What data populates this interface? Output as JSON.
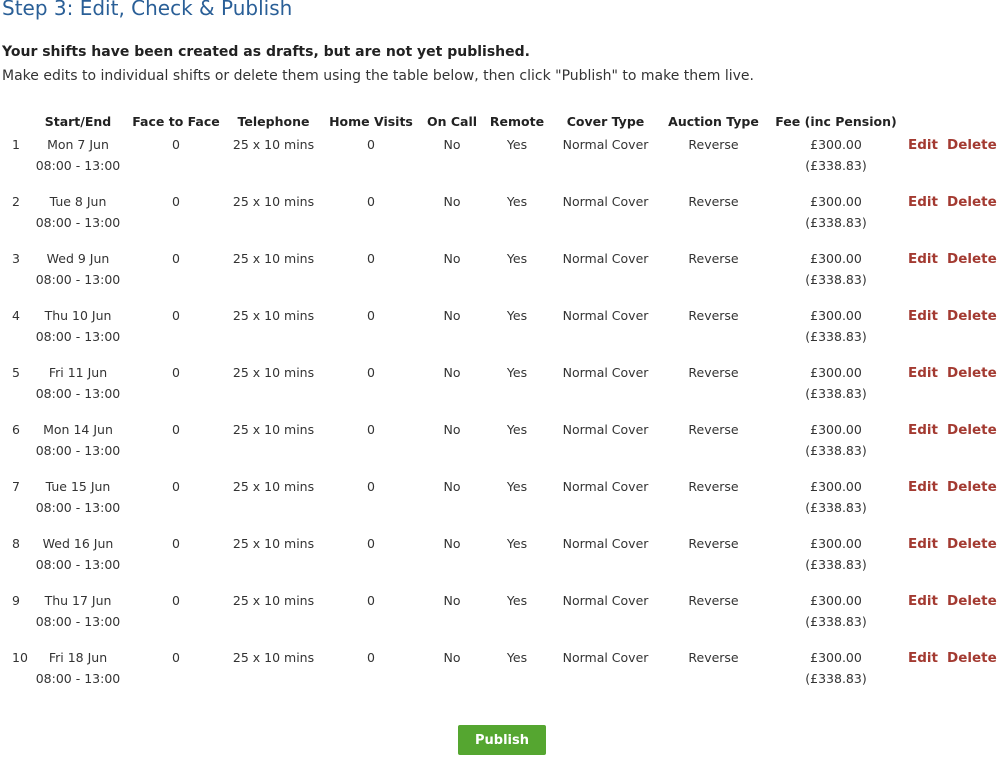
{
  "page": {
    "title": "Step 3: Edit, Check & Publish",
    "subhead": "Your shifts have been created as drafts, but are not yet published.",
    "instructions": "Make edits to individual shifts or delete them using the table below, then click \"Publish\" to make them live."
  },
  "table": {
    "headers": {
      "num": "",
      "start_end": "Start/End",
      "face_to_face": "Face to Face",
      "telephone": "Telephone",
      "home_visits": "Home Visits",
      "on_call": "On Call",
      "remote": "Remote",
      "cover_type": "Cover Type",
      "auction_type": "Auction Type",
      "fee": "Fee (inc Pension)"
    },
    "actions": {
      "edit": "Edit",
      "delete": "Delete"
    },
    "rows": [
      {
        "num": "1",
        "date": "Mon 7 Jun",
        "time": "08:00 - 13:00",
        "face_to_face": "0",
        "telephone": "25 x 10 mins",
        "home_visits": "0",
        "on_call": "No",
        "remote": "Yes",
        "cover_type": "Normal Cover",
        "auction_type": "Reverse",
        "fee": "£300.00",
        "fee_pension": "(£338.83)"
      },
      {
        "num": "2",
        "date": "Tue 8 Jun",
        "time": "08:00 - 13:00",
        "face_to_face": "0",
        "telephone": "25 x 10 mins",
        "home_visits": "0",
        "on_call": "No",
        "remote": "Yes",
        "cover_type": "Normal Cover",
        "auction_type": "Reverse",
        "fee": "£300.00",
        "fee_pension": "(£338.83)"
      },
      {
        "num": "3",
        "date": "Wed 9 Jun",
        "time": "08:00 - 13:00",
        "face_to_face": "0",
        "telephone": "25 x 10 mins",
        "home_visits": "0",
        "on_call": "No",
        "remote": "Yes",
        "cover_type": "Normal Cover",
        "auction_type": "Reverse",
        "fee": "£300.00",
        "fee_pension": "(£338.83)"
      },
      {
        "num": "4",
        "date": "Thu 10 Jun",
        "time": "08:00 - 13:00",
        "face_to_face": "0",
        "telephone": "25 x 10 mins",
        "home_visits": "0",
        "on_call": "No",
        "remote": "Yes",
        "cover_type": "Normal Cover",
        "auction_type": "Reverse",
        "fee": "£300.00",
        "fee_pension": "(£338.83)"
      },
      {
        "num": "5",
        "date": "Fri 11 Jun",
        "time": "08:00 - 13:00",
        "face_to_face": "0",
        "telephone": "25 x 10 mins",
        "home_visits": "0",
        "on_call": "No",
        "remote": "Yes",
        "cover_type": "Normal Cover",
        "auction_type": "Reverse",
        "fee": "£300.00",
        "fee_pension": "(£338.83)"
      },
      {
        "num": "6",
        "date": "Mon 14 Jun",
        "time": "08:00 - 13:00",
        "face_to_face": "0",
        "telephone": "25 x 10 mins",
        "home_visits": "0",
        "on_call": "No",
        "remote": "Yes",
        "cover_type": "Normal Cover",
        "auction_type": "Reverse",
        "fee": "£300.00",
        "fee_pension": "(£338.83)"
      },
      {
        "num": "7",
        "date": "Tue 15 Jun",
        "time": "08:00 - 13:00",
        "face_to_face": "0",
        "telephone": "25 x 10 mins",
        "home_visits": "0",
        "on_call": "No",
        "remote": "Yes",
        "cover_type": "Normal Cover",
        "auction_type": "Reverse",
        "fee": "£300.00",
        "fee_pension": "(£338.83)"
      },
      {
        "num": "8",
        "date": "Wed 16 Jun",
        "time": "08:00 - 13:00",
        "face_to_face": "0",
        "telephone": "25 x 10 mins",
        "home_visits": "0",
        "on_call": "No",
        "remote": "Yes",
        "cover_type": "Normal Cover",
        "auction_type": "Reverse",
        "fee": "£300.00",
        "fee_pension": "(£338.83)"
      },
      {
        "num": "9",
        "date": "Thu 17 Jun",
        "time": "08:00 - 13:00",
        "face_to_face": "0",
        "telephone": "25 x 10 mins",
        "home_visits": "0",
        "on_call": "No",
        "remote": "Yes",
        "cover_type": "Normal Cover",
        "auction_type": "Reverse",
        "fee": "£300.00",
        "fee_pension": "(£338.83)"
      },
      {
        "num": "10",
        "date": "Fri 18 Jun",
        "time": "08:00 - 13:00",
        "face_to_face": "0",
        "telephone": "25 x 10 mins",
        "home_visits": "0",
        "on_call": "No",
        "remote": "Yes",
        "cover_type": "Normal Cover",
        "auction_type": "Reverse",
        "fee": "£300.00",
        "fee_pension": "(£338.83)"
      }
    ]
  },
  "publish_label": "Publish",
  "colors": {
    "title": "#2a5f97",
    "action_link": "#a33a31",
    "publish_button": "#55a630"
  }
}
